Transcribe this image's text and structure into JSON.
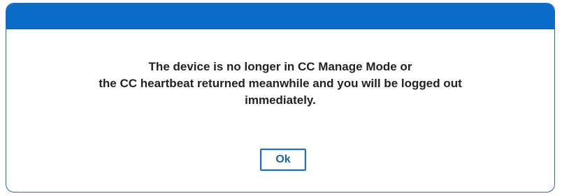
{
  "dialog": {
    "message_lines": [
      "The device is no longer in CC Manage Mode or",
      "the CC heartbeat returned meanwhile and you will be logged out",
      "immediately."
    ],
    "ok_label": "Ok"
  },
  "colors": {
    "header": "#0a6cc9",
    "border": "#1f6fb7",
    "text": "#222222",
    "button_text": "#1a63a6"
  }
}
